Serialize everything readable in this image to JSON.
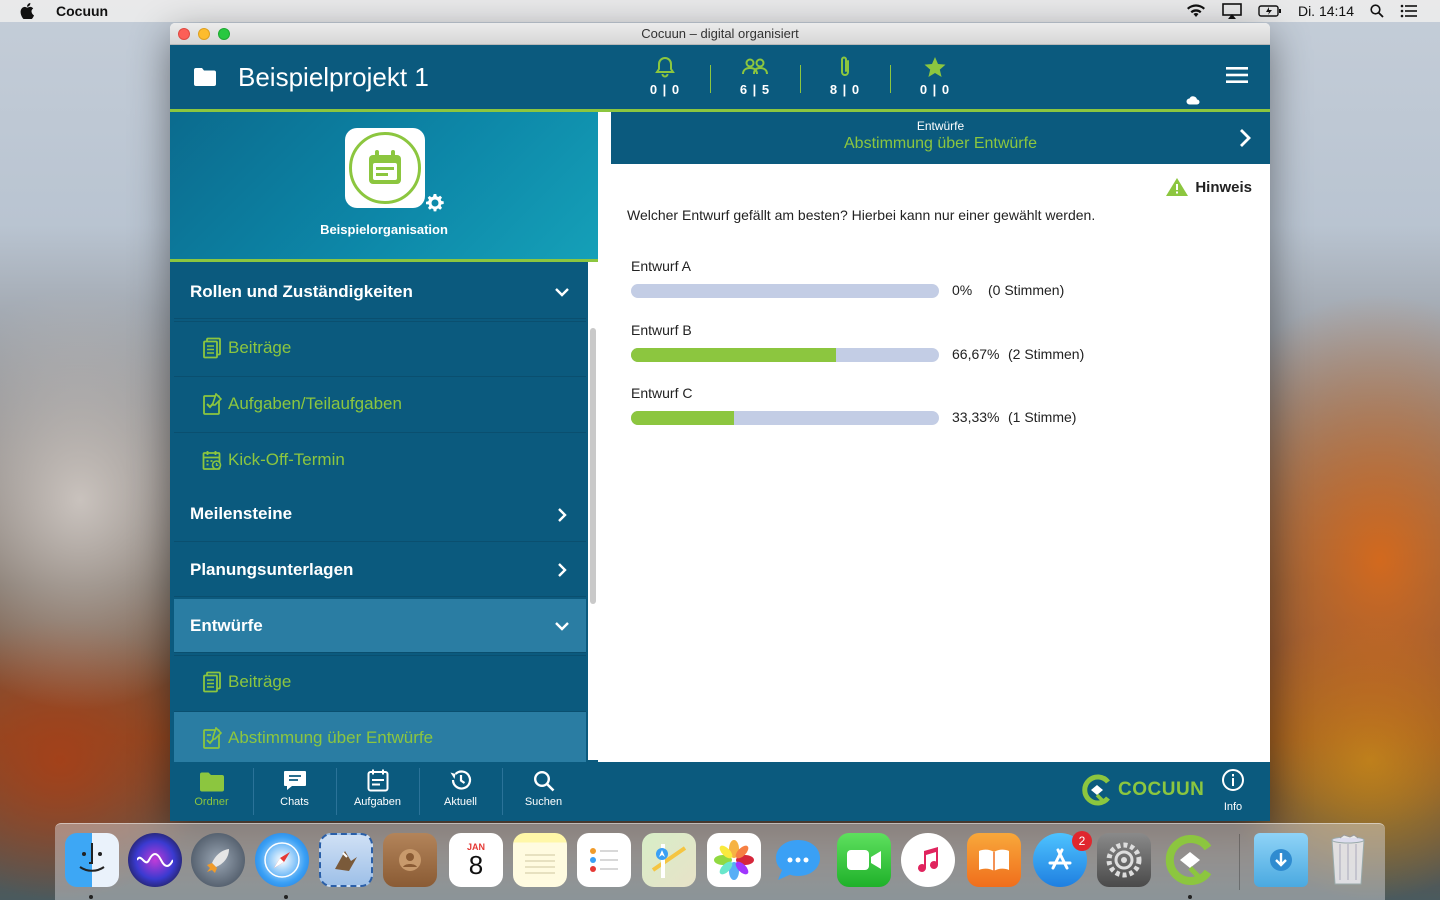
{
  "menubar": {
    "app_name": "Cocuun",
    "clock": "Di. 14:14"
  },
  "window": {
    "title": "Cocuun – digital organisiert"
  },
  "header": {
    "project_title": "Beispielprojekt 1",
    "stats": [
      {
        "icon": "bell-icon",
        "value": "0 | 0"
      },
      {
        "icon": "people-icon",
        "value": "6 | 5"
      },
      {
        "icon": "paperclip-icon",
        "value": "8 | 0"
      },
      {
        "icon": "star-icon",
        "value": "0 | 0"
      }
    ]
  },
  "sidebar": {
    "organisation": "Beispielorganisation",
    "items": [
      {
        "label": "Rollen und Zuständigkeiten",
        "type": "section",
        "chevron": "down"
      },
      {
        "label": "Beiträge",
        "type": "sub",
        "icon": "posts-icon"
      },
      {
        "label": "Aufgaben/Teilaufgaben",
        "type": "sub",
        "icon": "tasks-icon"
      },
      {
        "label": "Kick-Off-Termin",
        "type": "sub",
        "icon": "calendar-event-icon"
      },
      {
        "label": "Meilensteine",
        "type": "section",
        "chevron": "right"
      },
      {
        "label": "Planungsunterlagen",
        "type": "section",
        "chevron": "right"
      },
      {
        "label": "Entwürfe",
        "type": "section",
        "chevron": "down"
      },
      {
        "label": "Beiträge",
        "type": "sub",
        "icon": "posts-icon"
      },
      {
        "label": "Abstimmung über Entwürfe",
        "type": "sub",
        "icon": "poll-icon"
      }
    ]
  },
  "content": {
    "breadcrumb": "Entwürfe",
    "title": "Abstimmung über Entwürfe",
    "hint_label": "Hinweis",
    "question": "Welcher Entwurf gefällt am besten? Hierbei kann nur einer gewählt werden.",
    "options": [
      {
        "name": "Entwurf A",
        "percent_text": "0%",
        "votes_text": "(0  Stimmen)",
        "fraction": 0.0
      },
      {
        "name": "Entwurf B",
        "percent_text": "66,67%",
        "votes_text": "(2  Stimmen)",
        "fraction": 0.6667
      },
      {
        "name": "Entwurf C",
        "percent_text": "33,33%",
        "votes_text": "(1  Stimme)",
        "fraction": 0.3333
      }
    ]
  },
  "bottombar": {
    "nav": [
      {
        "label": "Ordner",
        "icon": "folder-icon",
        "active": true
      },
      {
        "label": "Chats",
        "icon": "chat-icon",
        "active": false
      },
      {
        "label": "Aufgaben",
        "icon": "tasks-icon",
        "active": false
      },
      {
        "label": "Aktuell",
        "icon": "history-icon",
        "active": false
      },
      {
        "label": "Suchen",
        "icon": "search-icon",
        "active": false
      }
    ],
    "brand": "COCUUN",
    "info_label": "Info"
  },
  "dock": {
    "calendar_month": "JAN",
    "calendar_day": "8",
    "appstore_badge": "2"
  },
  "colors": {
    "primary": "#0b5a7e",
    "accent": "#8cc63f",
    "highlight": "#2a7da3",
    "bar_empty": "#c3cde5"
  }
}
